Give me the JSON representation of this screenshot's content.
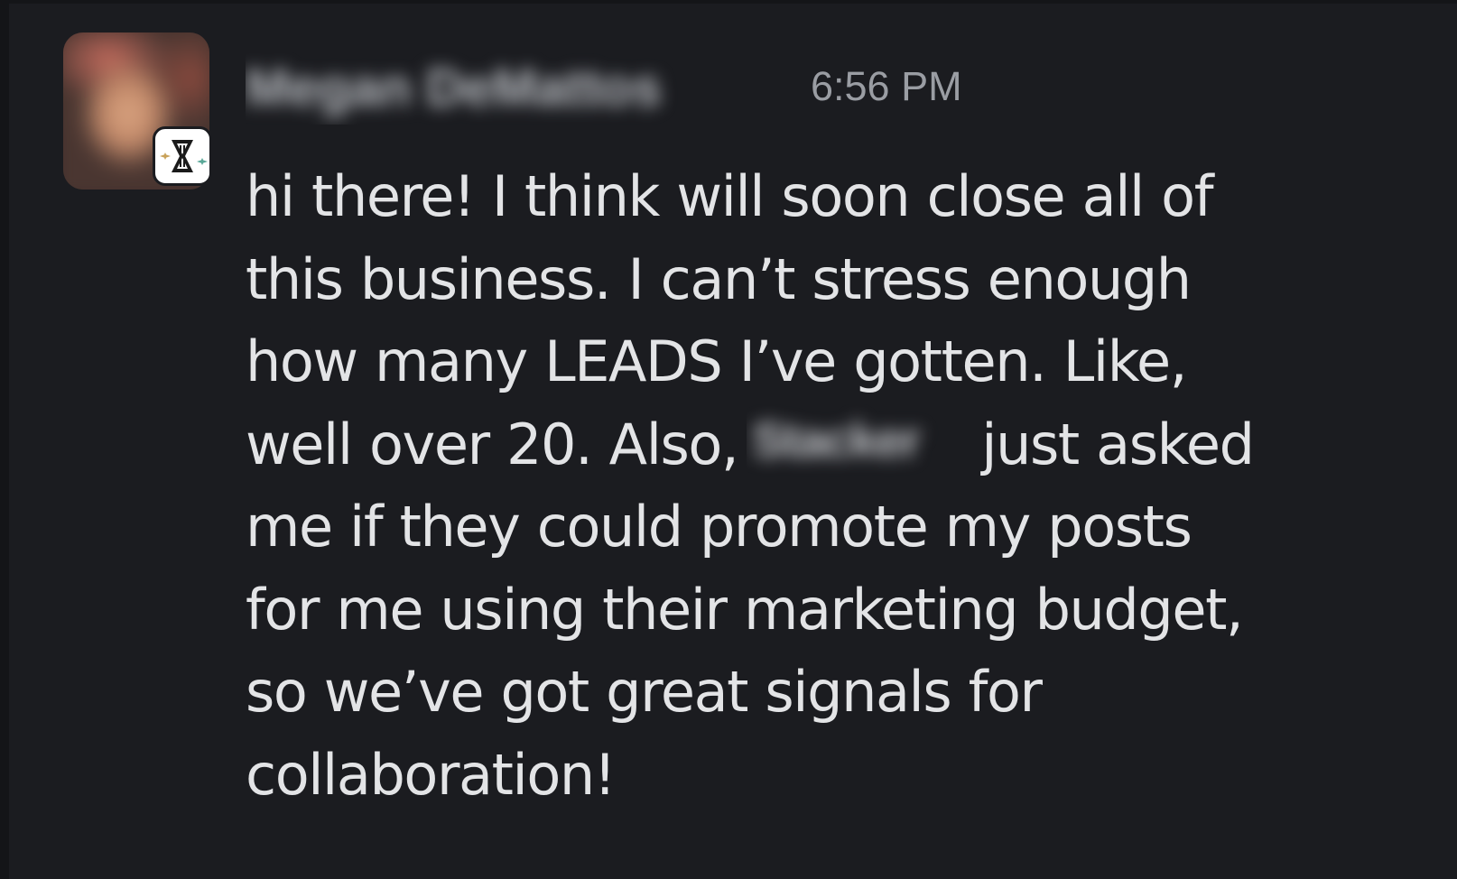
{
  "message": {
    "sender_name": "Megan DeMattos",
    "timestamp": "6:56 PM",
    "text_lines": [
      "hi there! I think will soon close all of",
      "this business. I can’t stress enough",
      "how many LEADS I’ve gotten. Like,",
      "well over 20. Also,",
      "me if they could promote my posts",
      "for me using their marketing budget,",
      "so we’ve got great signals for",
      "collaboration!"
    ],
    "line4_after_redaction": "just asked",
    "redacted_company": "Stacker",
    "badge_icon": "workspace-logo-icon",
    "avatar": "user-avatar-blurred"
  },
  "colors": {
    "background": "#1b1c20",
    "text": "#e3e4e6",
    "timestamp": "#9a9da3"
  }
}
